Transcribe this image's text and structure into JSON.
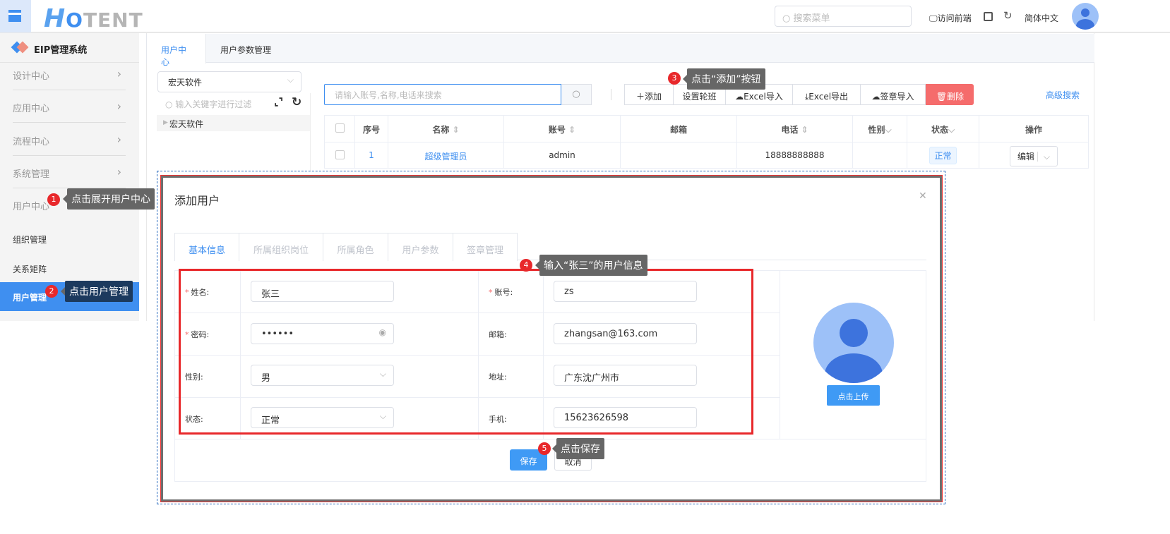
{
  "header": {
    "logo": "HOTENT",
    "search_placeholder": "搜索菜单",
    "visit_front": "访问前端",
    "language": "简体中文"
  },
  "sidebar": {
    "title": "EIP管理系统",
    "items": [
      {
        "label": "设计中心"
      },
      {
        "label": "应用中心"
      },
      {
        "label": "流程中心"
      },
      {
        "label": "系统管理"
      },
      {
        "label": "用户中心"
      }
    ],
    "sub_items": [
      {
        "label": "组织管理"
      },
      {
        "label": "关系矩阵"
      },
      {
        "label": "用户管理"
      }
    ]
  },
  "tabs": [
    {
      "label": "用户中心"
    },
    {
      "label": "用户参数管理"
    }
  ],
  "org": {
    "selected": "宏天软件",
    "filter_placeholder": "输入关键字进行过滤",
    "tree_node": "宏天软件"
  },
  "toolbar": {
    "search_placeholder": "请输入账号,名称,电话来搜索",
    "add": "添加",
    "set_shift": "设置轮班",
    "excel_import": "Excel导入",
    "excel_export": "Excel导出",
    "seal_import": "签章导入",
    "delete": "删除",
    "advanced_search": "高级搜索"
  },
  "table": {
    "columns": [
      "序号",
      "名称",
      "账号",
      "邮箱",
      "电话",
      "性别",
      "状态",
      "操作"
    ],
    "rows": [
      {
        "index": "1",
        "name": "超级管理员",
        "account": "admin",
        "email": "",
        "phone": "18888888888",
        "gender": "",
        "status": "正常",
        "action": "编辑"
      }
    ]
  },
  "modal": {
    "title": "添加用户",
    "tabs": [
      "基本信息",
      "所属组织岗位",
      "所属角色",
      "用户参数",
      "签章管理"
    ],
    "fields": {
      "name_label": "姓名:",
      "name": "张三",
      "account_label": "账号:",
      "account": "zs",
      "password_label": "密码:",
      "password": "••••••",
      "email_label": "邮箱:",
      "email": "zhangsan@163.com",
      "gender_label": "性别:",
      "gender": "男",
      "address_label": "地址:",
      "address": "广东沈广州市",
      "status_label": "状态:",
      "status": "正常",
      "mobile_label": "手机:",
      "mobile": "15623626598"
    },
    "upload": "点击上传",
    "save": "保存",
    "cancel": "取消"
  },
  "annotations": [
    {
      "num": "1",
      "text": "点击展开用户中心"
    },
    {
      "num": "2",
      "text": "点击用户管理"
    },
    {
      "num": "3",
      "text": "点击“添加”按钮"
    },
    {
      "num": "4",
      "text": "输入“张三”的用户信息"
    },
    {
      "num": "5",
      "text": "点击保存"
    }
  ],
  "colors": {
    "primary": "#3f8ff0",
    "danger": "#f56c6c",
    "annotation": "#e8282b"
  }
}
